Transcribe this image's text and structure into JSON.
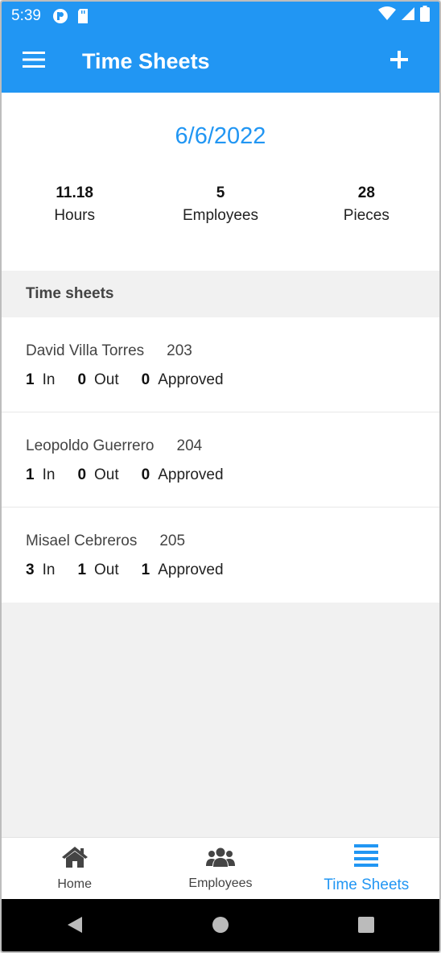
{
  "status_bar": {
    "time": "5:39"
  },
  "app_bar": {
    "title": "Time Sheets"
  },
  "summary": {
    "date": "6/6/2022",
    "stats": [
      {
        "value": "11.18",
        "label": "Hours"
      },
      {
        "value": "5",
        "label": "Employees"
      },
      {
        "value": "28",
        "label": "Pieces"
      }
    ]
  },
  "section": {
    "title": "Time sheets"
  },
  "rows": [
    {
      "name": "David Villa Torres",
      "number": "203",
      "in": "1",
      "in_label": "In",
      "out": "0",
      "out_label": "Out",
      "approved": "0",
      "approved_label": "Approved"
    },
    {
      "name": "Leopoldo Guerrero",
      "number": "204",
      "in": "1",
      "in_label": "In",
      "out": "0",
      "out_label": "Out",
      "approved": "0",
      "approved_label": "Approved"
    },
    {
      "name": "Misael Cebreros",
      "number": "205",
      "in": "3",
      "in_label": "In",
      "out": "1",
      "out_label": "Out",
      "approved": "1",
      "approved_label": "Approved"
    }
  ],
  "bottom_nav": [
    {
      "label": "Home",
      "icon": "home-icon"
    },
    {
      "label": "Employees",
      "icon": "people-icon"
    },
    {
      "label": "Time Sheets",
      "icon": "list-icon",
      "active": true
    }
  ],
  "colors": {
    "primary": "#2196f3",
    "background": "#f1f1f1"
  }
}
